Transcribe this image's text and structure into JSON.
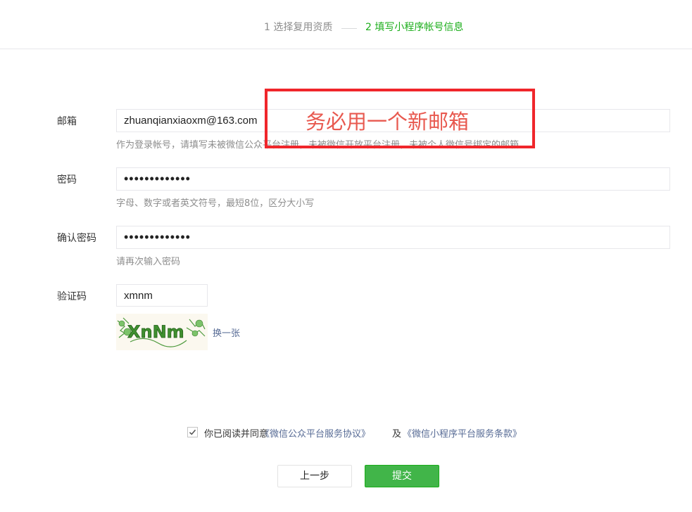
{
  "steps": [
    {
      "label": "1 选择复用资质"
    },
    {
      "label": "2 填写小程序帐号信息"
    }
  ],
  "form": {
    "email": {
      "label": "邮箱",
      "value": "zhuanqianxiaoxm@163.com",
      "hint": "作为登录帐号，请填写未被微信公众平台注册，未被微信开放平台注册，未被个人微信号绑定的邮箱"
    },
    "password": {
      "label": "密码",
      "value": "•••••••••••••",
      "hint": "字母、数字或者英文符号，最短8位，区分大小写"
    },
    "confirm": {
      "label": "确认密码",
      "value": "•••••••••••••",
      "hint": "请再次输入密码"
    },
    "captcha": {
      "label": "验证码",
      "value": "xmnm",
      "image_text": "XnNm",
      "refresh_label": "换一张"
    }
  },
  "annotation": {
    "text": "务必用一个新邮箱",
    "color": "#f0262b"
  },
  "agreement": {
    "checked": true,
    "text": "你已阅读并同意",
    "link1": "《微信公众平台服务协议》",
    "mid": "及",
    "link2": "《微信小程序平台服务条款》"
  },
  "buttons": {
    "prev_label": "上一步",
    "submit_label": "提交"
  },
  "colors": {
    "accent_green": "#1aad19",
    "link_blue": "#576b95"
  }
}
